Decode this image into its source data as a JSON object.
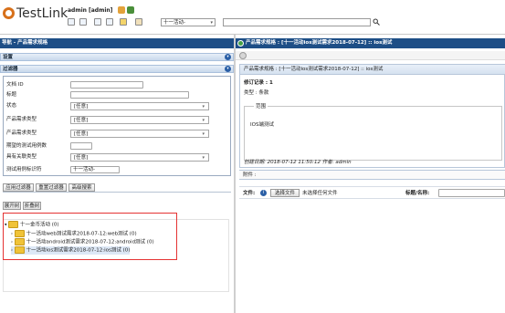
{
  "header": {
    "logo_text": "TestLink",
    "user": "admin [admin]",
    "project_value": "十一活动-",
    "search_value": ""
  },
  "left": {
    "panel_title": "导航 - 产品需求规格",
    "settings_label": "设置",
    "filter_label": "过滤器",
    "filters": {
      "doc_id": "文档 ID",
      "title": "标题",
      "status": "状态",
      "status_value": "[任意]",
      "product_type": "产品需求类型",
      "product_type_value": "[任意]",
      "req_type": "产品需求类型",
      "req_type_value": "[任意]",
      "expected_cases": "期望的测试用例数",
      "relation_type": "具有关联类型",
      "relation_value": "[任意]",
      "test_case_id": "测试用例标识符",
      "test_case_value": "十一活动-"
    },
    "buttons": {
      "apply": "应用过滤器",
      "reset": "重置过滤器",
      "advanced": "高级搜索",
      "expand": "展开树",
      "collapse": "折叠树"
    },
    "tree": {
      "root": "十一金币活动 (0)",
      "items": [
        "十一活动web测试需求2018-07-12:web测试 (0)",
        "十一活动android测试需求2018-07-12:android测试 (0)",
        "十一活动ios测试需求2018-07-12:ios测试 (0)"
      ]
    }
  },
  "right": {
    "panel_title": "产品需求规格 : [十一活动ios测试需求2018-07-12] :: ios测试",
    "req_title": "产品需求规格 : [十一活动ios测试需求2018-07-12] :: ios测试",
    "revision": "修订记录 : 1",
    "type": "类型 : 条款",
    "scope_label": "范围",
    "scope_text": "IOS端测试",
    "created": "创建日期: 2018-07-12 11:50:12  作者: admin",
    "attachments_label": "附件 :",
    "file_label": "文件:",
    "choose_file": "选择文件",
    "no_file": "未选择任何文件",
    "title_label": "标题/名称:"
  }
}
